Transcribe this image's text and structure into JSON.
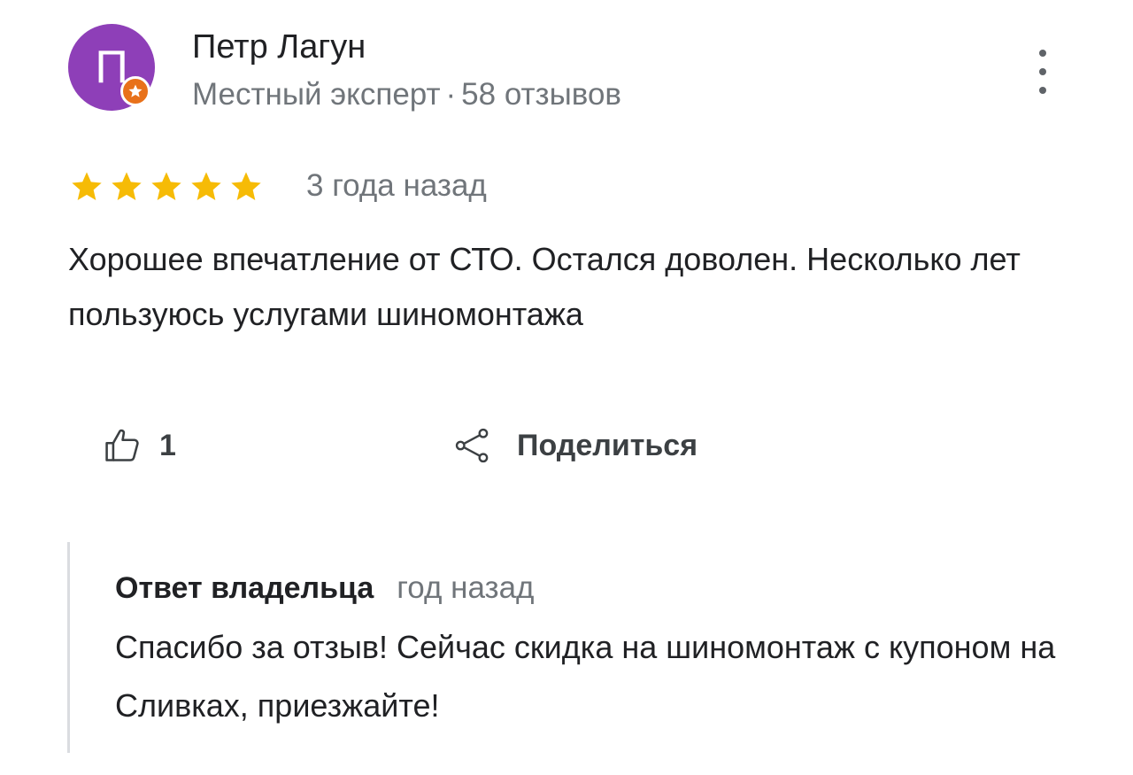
{
  "author": {
    "avatar_letter": "П",
    "name": "Петр Лагун",
    "level": "Местный эксперт",
    "separator": "·",
    "reviews_count": "58 отзывов",
    "avatar_color": "#8e3fb8",
    "badge_color": "#e8711a",
    "badge_icon": "local-guide-star-icon"
  },
  "more_menu_icon": "more-vert-icon",
  "review": {
    "rating": 5,
    "max_rating": 5,
    "star_color": "#f6bb06",
    "date": "3 года назад",
    "text": "Хорошее впечатление от СТО. Остался доволен. Несколько лет пользуюсь услугами шиномонтажа"
  },
  "actions": {
    "like_icon": "thumb-up-icon",
    "like_count": "1",
    "share_icon": "share-icon",
    "share_label": "Поделиться"
  },
  "owner_reply": {
    "title": "Ответ владельца",
    "date": "год назад",
    "text": "Спасибо за отзыв! Сейчас скидка на шиномонтаж с купоном на Сливках, приезжайте!"
  }
}
